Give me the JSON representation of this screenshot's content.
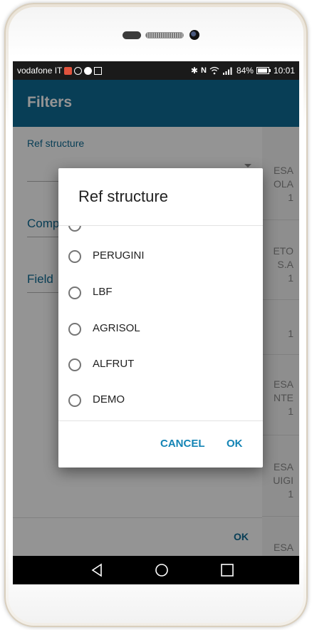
{
  "status_bar": {
    "carrier": "vodafone IT",
    "battery": "84%",
    "time": "10:01"
  },
  "app": {
    "title": "Filters",
    "filters": {
      "ref_structure_label": "Ref structure",
      "company_label_partial": "Comp",
      "field_label_partial": "Field"
    },
    "ok_label": "OK"
  },
  "background_list": {
    "rows": [
      {
        "line1": "ESA",
        "line2": "OLA",
        "count": "1"
      },
      {
        "line1": "ETO",
        "line2": "S.A",
        "count": "1"
      },
      {
        "line1": "",
        "line2": "",
        "count": "1"
      },
      {
        "line1": "ESA",
        "line2": "NTE",
        "count": "1"
      },
      {
        "line1": "ESA",
        "line2": "UIGI",
        "count": "1"
      },
      {
        "line1": "ESA",
        "line2": "",
        "count": ""
      }
    ]
  },
  "dialog": {
    "title": "Ref structure",
    "options": [
      "PERUGINI",
      "LBF",
      "AGRISOL",
      "ALFRUT",
      "DEMO"
    ],
    "cancel_label": "CANCEL",
    "ok_label": "OK"
  },
  "colors": {
    "toolbar": "#0f6b94",
    "accent": "#1384b5"
  },
  "icons": [
    "bluetooth-icon",
    "nfc-icon",
    "wifi-icon",
    "signal-icon",
    "battery-icon",
    "back-icon",
    "home-icon",
    "recents-icon"
  ]
}
